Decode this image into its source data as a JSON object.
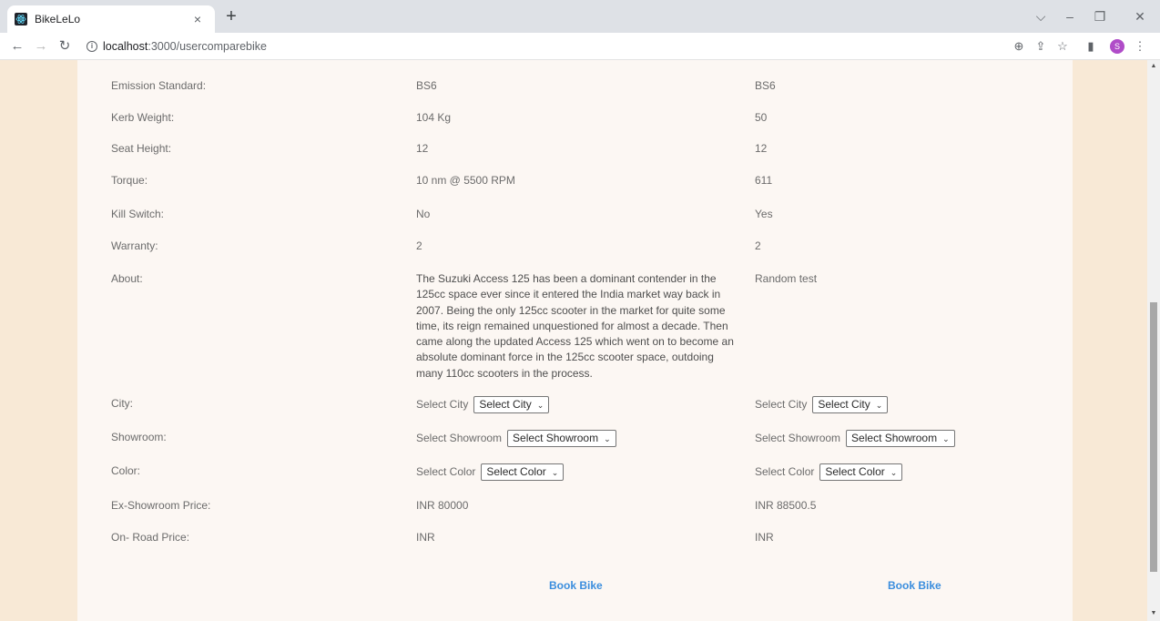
{
  "browser": {
    "tab_title": "BikeLeLo",
    "tab_close": "×",
    "new_tab": "+",
    "url_host": "localhost",
    "url_path": ":3000/usercomparebike",
    "window_controls": [
      "⌵",
      "–",
      "❐",
      "✕"
    ],
    "avatar_letter": "S"
  },
  "specs": [
    {
      "label": "Emission Standard:",
      "bike1": "BS6",
      "bike2": "BS6"
    },
    {
      "label": "Kerb Weight:",
      "bike1": "104 Kg",
      "bike2": "50"
    },
    {
      "label": "Seat Height:",
      "bike1": "12",
      "bike2": "12"
    },
    {
      "label": "Torque:",
      "bike1": "10 nm @ 5500 RPM",
      "bike2": "611"
    },
    {
      "label": "Kill Switch:",
      "bike1": "No",
      "bike2": "Yes"
    },
    {
      "label": "Warranty:",
      "bike1": "2",
      "bike2": "2"
    }
  ],
  "about": {
    "label": "About:",
    "bike1_lines": [
      "The Suzuki Access 125 has been a dominant contender in the",
      "125cc space ever since it entered the India market way back in",
      "2007. Being the only 125cc scooter in the market for quite some",
      "time, its reign remained unquestioned for almost a decade. Then",
      "came along the updated Access 125 which went on to become an",
      "absolute dominant force in the 125cc scooter space, outdoing",
      "many 110cc scooters in the process."
    ],
    "bike2": "Random test"
  },
  "selects": {
    "city": {
      "label": "City:",
      "prompt": "Select City",
      "value": "Select City"
    },
    "showroom": {
      "label": "Showroom:",
      "prompt": "Select Showroom",
      "value": "Select Showroom"
    },
    "color": {
      "label": "Color:",
      "prompt": "Select Color",
      "value": "Select Color"
    }
  },
  "prices": {
    "ex_showroom": {
      "label": "Ex-Showroom Price:",
      "bike1": "INR 80000",
      "bike2": "INR 88500.5"
    },
    "on_road": {
      "label": "On- Road Price:",
      "bike1": "INR",
      "bike2": "INR"
    }
  },
  "actions": {
    "book_bike": "Book Bike"
  },
  "colors": {
    "page_bg": "#f8e9d6",
    "card_bg": "#fcf7f3",
    "link": "#3b8ede"
  }
}
